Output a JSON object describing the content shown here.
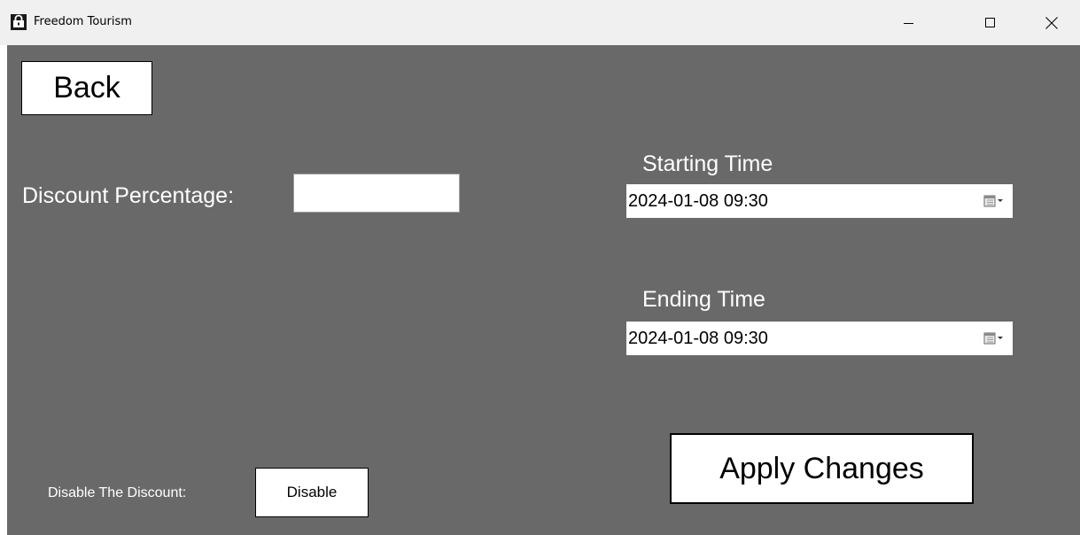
{
  "window": {
    "title": "Freedom Tourism",
    "controls": {
      "minimize_icon": "minimize-icon",
      "maximize_icon": "maximize-icon",
      "close_icon": "close-icon"
    }
  },
  "form": {
    "back_label": "Back",
    "discount": {
      "label": "Discount Percentage:",
      "value": ""
    },
    "starting_time": {
      "label": "Starting Time",
      "value": "2024-01-08 09:30"
    },
    "ending_time": {
      "label": "Ending Time",
      "value": "2024-01-08 09:30"
    },
    "apply_label": "Apply Changes",
    "disable": {
      "label": "Disable The Discount:",
      "button_label": "Disable"
    }
  },
  "colors": {
    "client_background": "#696969",
    "titlebar_background": "#f0f0f0",
    "text_on_dark": "#ffffff"
  }
}
